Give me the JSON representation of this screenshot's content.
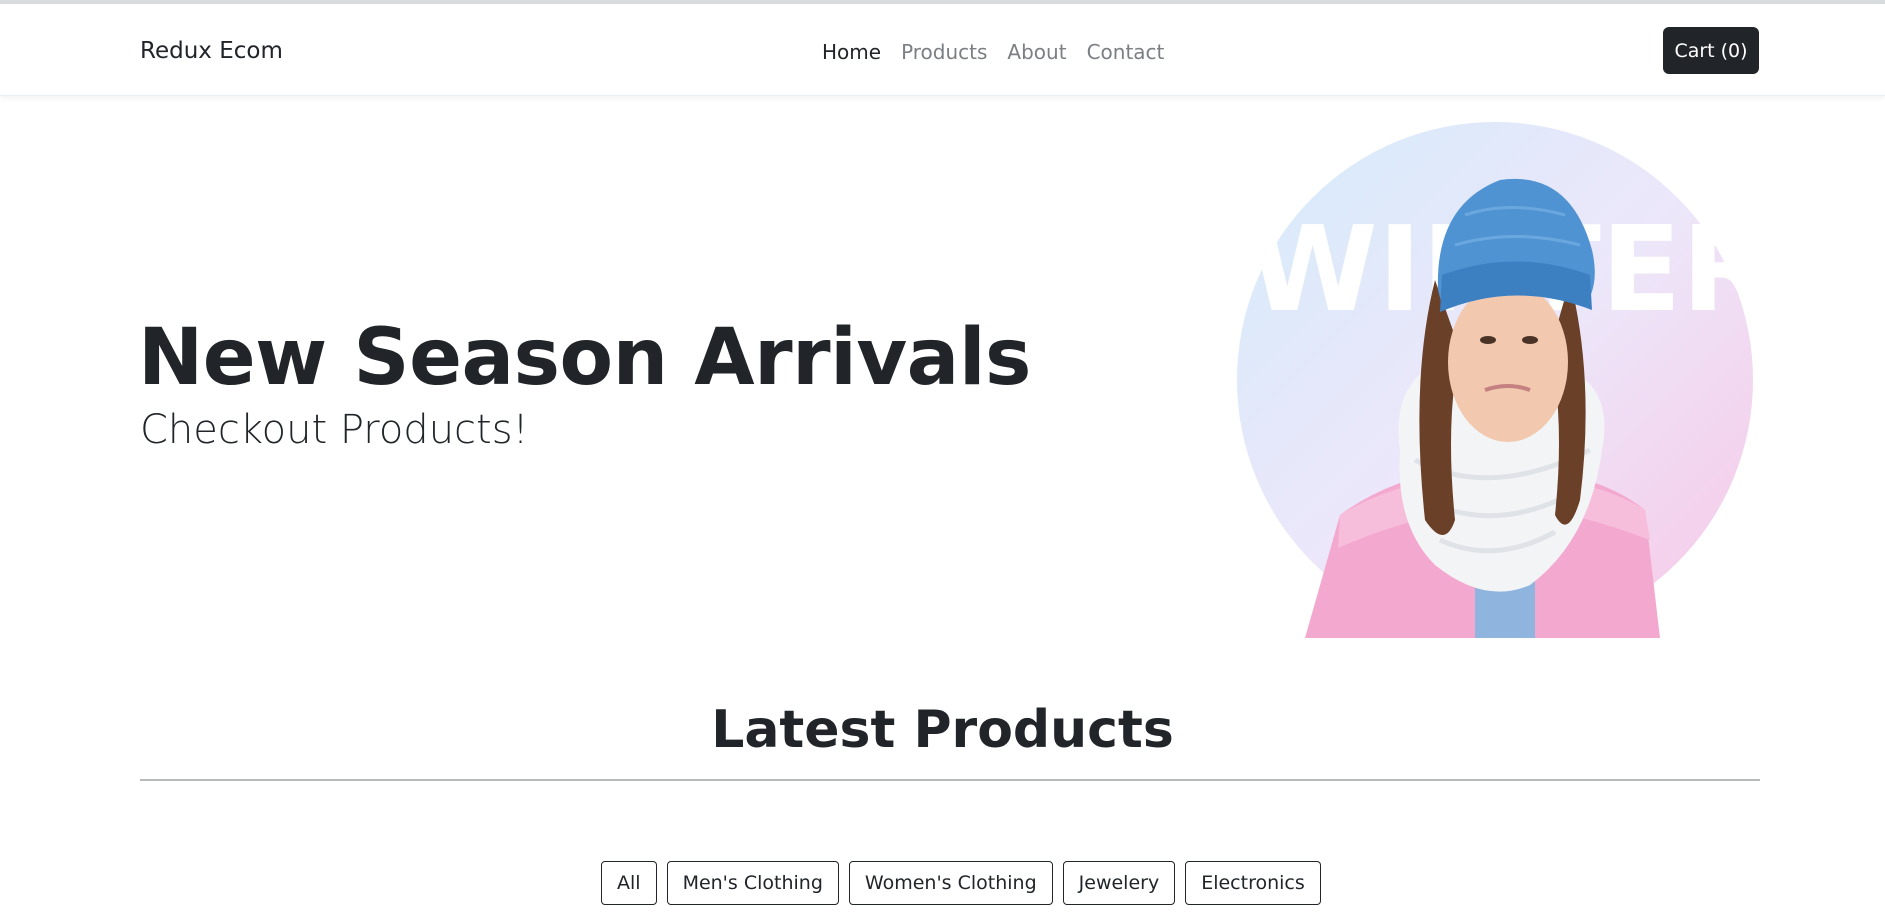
{
  "nav": {
    "brand": "Redux Ecom",
    "links": [
      {
        "label": "Home",
        "active": true
      },
      {
        "label": "Products",
        "active": false
      },
      {
        "label": "About",
        "active": false
      },
      {
        "label": "Contact",
        "active": false
      }
    ],
    "cart_label": "Cart (0)"
  },
  "hero": {
    "title": "New Season Arrivals",
    "subtitle": "Checkout Products!",
    "image_word": "WINTER"
  },
  "products_section": {
    "title": "Latest Products",
    "filters": [
      "All",
      "Men's Clothing",
      "Women's Clothing",
      "Jewelery",
      "Electronics"
    ]
  },
  "colors": {
    "primary_dark": "#212529",
    "muted_link": "#7b7f84",
    "divider": "#b7babd"
  }
}
